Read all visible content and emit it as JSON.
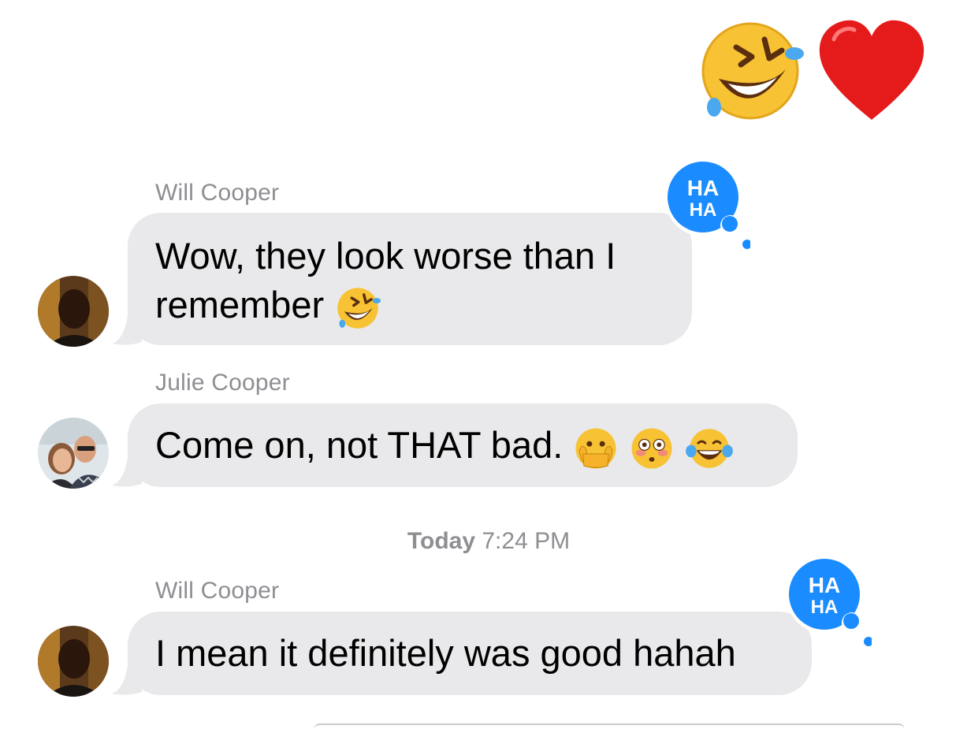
{
  "top_reactions": {
    "icons": [
      "rolling-on-floor-laughing-emoji",
      "red-heart-emoji"
    ]
  },
  "messages": [
    {
      "sender": "Will Cooper",
      "text_line1": "Wow, they look worse than I",
      "text_line2": "remember",
      "trailing_emojis": [
        "rolling-on-floor-laughing-emoji"
      ],
      "reaction": "HA HA",
      "reaction_line1": "HA",
      "reaction_line2": "HA"
    },
    {
      "sender": "Julie Cooper",
      "text": "Come on, not THAT bad.",
      "trailing_emojis": [
        "face-with-open-eyes-and-hand-over-mouth-emoji",
        "flushed-face-emoji",
        "face-with-tears-of-joy-emoji"
      ]
    },
    {
      "sender": "Will Cooper",
      "text": "I mean it definitely was good hahah",
      "reaction_line1": "HA",
      "reaction_line2": "HA"
    }
  ],
  "timestamp": {
    "day": "Today",
    "time": "7:24 PM"
  },
  "colors": {
    "bubble_gray": "#e9e9eb",
    "reaction_blue": "#1a8cff",
    "label_gray": "#8e8e93"
  }
}
